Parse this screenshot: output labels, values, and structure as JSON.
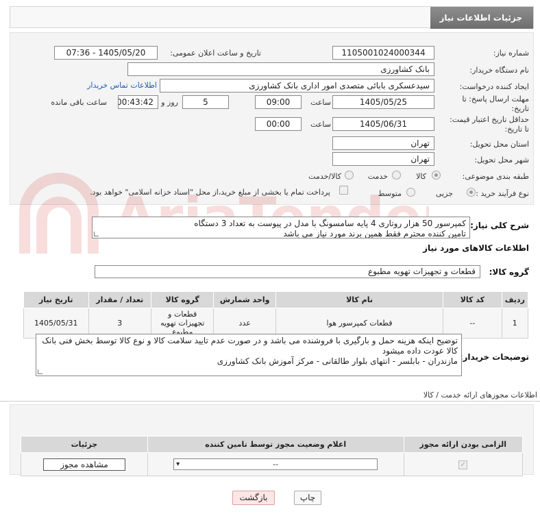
{
  "header": {
    "title": "جزئیات اطلاعات نیاز"
  },
  "form": {
    "need_number_label": "شماره نیاز:",
    "need_number": "1105001024000344",
    "announce_label": "تاریخ و ساعت اعلان عمومی:",
    "announce_value": "1405/05/20 - 07:36",
    "buyer_org_label": "نام دستگاه خریدار:",
    "buyer_org": "بانک کشاورزی",
    "requester_label": "ایجاد کننده درخواست:",
    "requester": "سیدعسکری بابائی متصدی امور اداری بانک کشاورزی",
    "contact_link": "اطلاعات تماس خریدار",
    "deadline_label_1": "مهلت ارسال پاسخ: تا",
    "deadline_label_2": "تاریخ:",
    "deadline_date": "1405/05/25",
    "time_label": "ساعت",
    "deadline_time": "09:00",
    "days_value": "5",
    "days_label": "روز و",
    "remaining_value": "00:43:42",
    "remaining_label": "ساعت باقی مانده",
    "validity_label_1": "حداقل تاریخ اعتبار قیمت:",
    "validity_label_2": "تا تاریخ:",
    "validity_date": "1405/06/31",
    "validity_time": "00:00",
    "province_label": "استان محل تحویل:",
    "province": "تهران",
    "city_label": "شهر محل تحویل:",
    "city": "تهران",
    "category_label": "طبقه بندی موضوعی:",
    "category_options": [
      "کالا",
      "خدمت",
      "کالا/خدمت"
    ],
    "process_label": "نوع فرآیند خرید :",
    "process_options": [
      "جزیی",
      "متوسط"
    ],
    "payment_text": "پرداخت تمام یا بخشی از مبلغ خرید،از محل \"اسناد خزانه اسلامی\" خواهد بود."
  },
  "description": {
    "label": "شرح کلی نیاز:",
    "line1": "کمپرسور 50 هزار  روتاری 4 پایه سامسونگ با مدل در پیوست  به تعداد 3 دستگاه",
    "line2": "تامین کننده محترم فقط همین برند مورد نیاز می باشد"
  },
  "goods_info": {
    "title": "اطلاعات کالاهای مورد نیاز",
    "group_label": "گروه کالا:",
    "group_value": "قطعات و تجهیزات تهویه مطبوع",
    "columns": [
      "ردیف",
      "کد کالا",
      "نام کالا",
      "واحد شمارش",
      "گروه کالا",
      "تعداد / مقدار",
      "تاریخ نیاز"
    ],
    "rows": [
      {
        "row": "1",
        "code": "--",
        "name": "قطعات کمپرسور هوا",
        "unit": "عدد",
        "group": "قطعات و تجهیزات تهویه مطبوع",
        "qty": "3",
        "date": "1405/05/31"
      }
    ]
  },
  "buyer_notes": {
    "label": "توضیحات خریدار:",
    "line1": "توضیح اینکه هزینه حمل و بارگیری با فروشنده می باشد و در صورت عدم تایید سلامت کالا  و نوع کالا  توسط  بخش فنی بانک",
    "line2": "کالا عودت داده میشود",
    "line3": "مازندران - بابلسر - انتهای بلوار طالقانی - مرکز آموزش بانک کشاورزی"
  },
  "permits": {
    "title": "اطلاعات مجوزهای ارائه خدمت / کالا",
    "columns": [
      "الزامی بودن ارائه مجوز",
      "اعلام وضعیت مجوز توسط تامین کننده",
      "جزئیات"
    ],
    "select_value": "--",
    "view_button": "مشاهده مجوز"
  },
  "actions": {
    "print": "چاپ",
    "back": "بازگشت"
  },
  "watermark": "AriaTender.neT"
}
